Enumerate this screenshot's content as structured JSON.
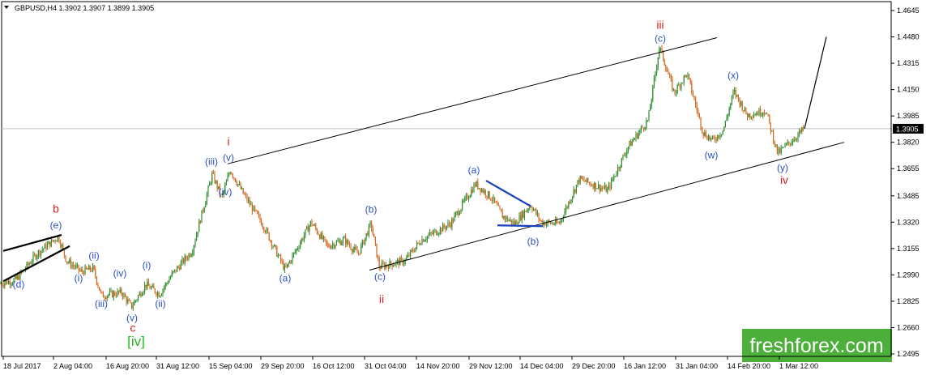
{
  "chart_data": {
    "type": "candlestick",
    "header": {
      "symbol": "GBPUSD,H4",
      "open": "1.3902",
      "high": "1.3907",
      "low": "1.3899",
      "close": "1.3905"
    },
    "current_price": "1.3905",
    "y_ticks": [
      "1.4645",
      "1.4480",
      "1.4315",
      "1.4150",
      "1.3985",
      "1.3820",
      "1.3655",
      "1.3485",
      "1.3320",
      "1.3155",
      "1.2990",
      "1.2825",
      "1.2660",
      "1.2495"
    ],
    "x_ticks": [
      "18 Jul 2017",
      "2 Aug 04:00",
      "16 Aug 20:00",
      "31 Aug 12:00",
      "15 Sep 04:00",
      "29 Sep 20:00",
      "16 Oct 12:00",
      "31 Oct 04:00",
      "14 Nov 20:00",
      "29 Nov 12:00",
      "14 Dec 04:00",
      "29 Dec 20:00",
      "16 Jan 12:00",
      "31 Jan 04:00",
      "14 Feb 20:00",
      "1 Mar 12:00"
    ],
    "price_path": [
      [
        0,
        1.2935
      ],
      [
        20,
        1.296
      ],
      [
        45,
        1.312
      ],
      [
        72,
        1.323
      ],
      [
        82,
        1.308
      ],
      [
        100,
        1.301
      ],
      [
        115,
        1.303
      ],
      [
        125,
        1.286
      ],
      [
        150,
        1.288
      ],
      [
        162,
        1.279
      ],
      [
        180,
        1.293
      ],
      [
        197,
        1.287
      ],
      [
        212,
        1.299
      ],
      [
        237,
        1.314
      ],
      [
        262,
        1.362
      ],
      [
        274,
        1.347
      ],
      [
        284,
        1.365
      ],
      [
        300,
        1.35
      ],
      [
        325,
        1.33
      ],
      [
        352,
        1.302
      ],
      [
        384,
        1.332
      ],
      [
        404,
        1.317
      ],
      [
        425,
        1.321
      ],
      [
        442,
        1.312
      ],
      [
        458,
        1.331
      ],
      [
        468,
        1.304
      ],
      [
        500,
        1.308
      ],
      [
        520,
        1.321
      ],
      [
        556,
        1.331
      ],
      [
        587,
        1.356
      ],
      [
        607,
        1.347
      ],
      [
        620,
        1.336
      ],
      [
        635,
        1.331
      ],
      [
        655,
        1.343
      ],
      [
        668,
        1.332
      ],
      [
        690,
        1.331
      ],
      [
        715,
        1.359
      ],
      [
        750,
        1.352
      ],
      [
        775,
        1.379
      ],
      [
        800,
        1.396
      ],
      [
        814,
        1.442
      ],
      [
        832,
        1.413
      ],
      [
        848,
        1.425
      ],
      [
        868,
        1.388
      ],
      [
        880,
        1.383
      ],
      [
        893,
        1.39
      ],
      [
        906,
        1.414
      ],
      [
        922,
        1.399
      ],
      [
        945,
        1.402
      ],
      [
        960,
        1.375
      ],
      [
        975,
        1.382
      ],
      [
        993,
        1.3905
      ]
    ],
    "projection": [
      [
        993,
        1.3905
      ],
      [
        1020,
        1.448
      ]
    ],
    "current_price_line": 1.3905,
    "wave_labels": [
      {
        "text": "b",
        "color": "#e02020",
        "x": 69,
        "y": 1.338
      },
      {
        "text": "(e)",
        "color": "#2a4fc0",
        "x": 69,
        "y": 1.328
      },
      {
        "text": "(d)",
        "color": "#2a4fc0",
        "x": 23,
        "y": 1.291
      },
      {
        "text": "(i)",
        "color": "#2a4fc0",
        "x": 97,
        "y": 1.295
      },
      {
        "text": "(ii)",
        "color": "#2a4fc0",
        "x": 116,
        "y": 1.309
      },
      {
        "text": "(iii)",
        "color": "#2a4fc0",
        "x": 125,
        "y": 1.279
      },
      {
        "text": "(iv)",
        "color": "#2a4fc0",
        "x": 148,
        "y": 1.298
      },
      {
        "text": "(v)",
        "color": "#2a4fc0",
        "x": 163,
        "y": 1.27
      },
      {
        "text": "c",
        "color": "#e02020",
        "x": 164,
        "y": 1.2635
      },
      {
        "text": "[iv]",
        "color": "#22bb22",
        "x": 168,
        "y": 1.2545
      },
      {
        "text": "(i)",
        "color": "#2a4fc0",
        "x": 181,
        "y": 1.303
      },
      {
        "text": "(ii)",
        "color": "#2a4fc0",
        "x": 198,
        "y": 1.279
      },
      {
        "text": "(iii)",
        "color": "#2a4fc0",
        "x": 261,
        "y": 1.368
      },
      {
        "text": "i",
        "color": "#e02020",
        "x": 282,
        "y": 1.38
      },
      {
        "text": "(v)",
        "color": "#2a4fc0",
        "x": 282,
        "y": 1.3705
      },
      {
        "text": "(iv)",
        "color": "#2a4fc0",
        "x": 278,
        "y": 1.349
      },
      {
        "text": "(a)",
        "color": "#2a4fc0",
        "x": 352,
        "y": 1.295
      },
      {
        "text": "(b)",
        "color": "#2a4fc0",
        "x": 458,
        "y": 1.338
      },
      {
        "text": "(c)",
        "color": "#2a4fc0",
        "x": 469,
        "y": 1.296
      },
      {
        "text": "ii",
        "color": "#e02020",
        "x": 471,
        "y": 1.2815
      },
      {
        "text": "(a)",
        "color": "#2a4fc0",
        "x": 585,
        "y": 1.3625
      },
      {
        "text": "(b)",
        "color": "#2a4fc0",
        "x": 658,
        "y": 1.318
      },
      {
        "text": "iii",
        "color": "#e02020",
        "x": 815,
        "y": 1.453
      },
      {
        "text": "(c)",
        "color": "#2a4fc0",
        "x": 815,
        "y": 1.445
      },
      {
        "text": "(x)",
        "color": "#2a4fc0",
        "x": 905,
        "y": 1.422
      },
      {
        "text": "(w)",
        "color": "#2a4fc0",
        "x": 878,
        "y": 1.372
      },
      {
        "text": "(y)",
        "color": "#2a4fc0",
        "x": 966,
        "y": 1.364
      },
      {
        "text": "iv",
        "color": "#e02020",
        "x": 968,
        "y": 1.356
      }
    ],
    "trendlines": [
      {
        "color": "#000000",
        "points": [
          [
            281,
            1.3685
          ],
          [
            885,
            1.4475
          ]
        ]
      },
      {
        "color": "#000000",
        "points": [
          [
            456,
            1.302
          ],
          [
            1042,
            1.382
          ]
        ]
      },
      {
        "color": "#000000",
        "points": [
          [
            4,
            1.314
          ],
          [
            76,
            1.324
          ]
        ],
        "bold": true
      },
      {
        "color": "#000000",
        "points": [
          [
            4,
            1.295
          ],
          [
            86,
            1.317
          ]
        ],
        "bold": true
      },
      {
        "color": "#1a3fbf",
        "points": [
          [
            600,
            1.358
          ],
          [
            655,
            1.342
          ]
        ],
        "bold": true
      },
      {
        "color": "#1a3fbf",
        "points": [
          [
            614,
            1.33
          ],
          [
            670,
            1.3295
          ]
        ],
        "bold": true
      }
    ],
    "colors": {
      "up_candle": "#2e8b2e",
      "down_candle": "#d2691e",
      "axis": "#000000",
      "price_tag_bg": "#000000",
      "price_tag_fg": "#ffffff"
    },
    "watermark": "freshforex.com"
  }
}
